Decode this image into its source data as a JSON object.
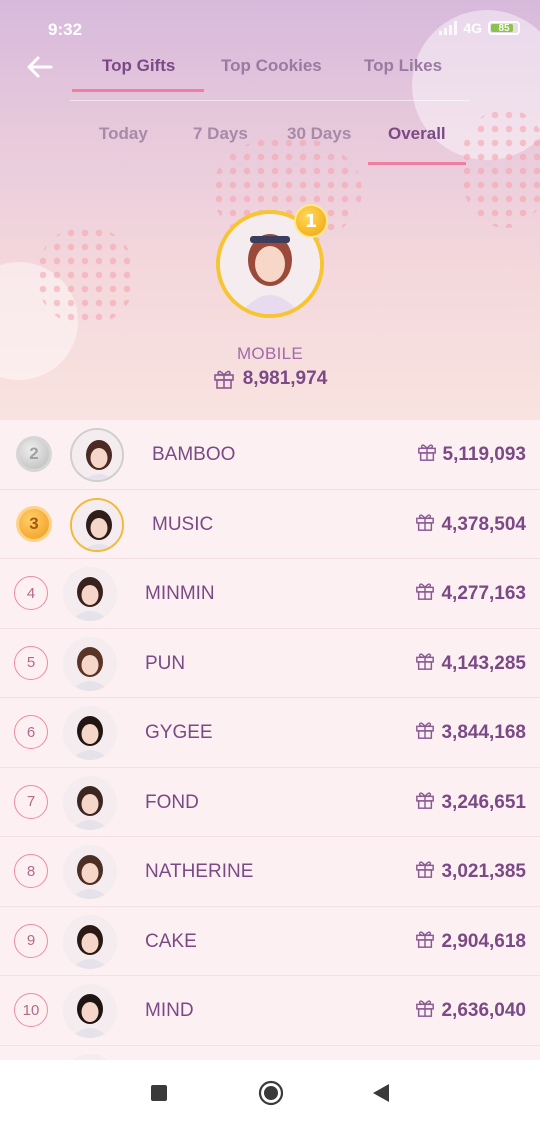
{
  "status": {
    "time": "9:32",
    "network": "4G",
    "battery": "85",
    "battery_level": 0.85
  },
  "nav": {
    "back_icon": "arrow-left-icon"
  },
  "tabs": [
    {
      "label": "Top Gifts",
      "active": true
    },
    {
      "label": "Top Cookies",
      "active": false
    },
    {
      "label": "Top Likes",
      "active": false
    }
  ],
  "periods": [
    {
      "label": "Today",
      "active": false
    },
    {
      "label": "7 Days",
      "active": false
    },
    {
      "label": "30 Days",
      "active": false
    },
    {
      "label": "Overall",
      "active": true
    }
  ],
  "top": {
    "rank": "1",
    "name": "MOBILE",
    "score": "8,981,974",
    "icon": "gift-icon"
  },
  "list": [
    {
      "rank": "2",
      "name": "BAMBOO",
      "score": "5,119,093",
      "medal": "silver"
    },
    {
      "rank": "3",
      "name": "MUSIC",
      "score": "4,378,504",
      "medal": "bronze"
    },
    {
      "rank": "4",
      "name": "MINMIN",
      "score": "4,277,163"
    },
    {
      "rank": "5",
      "name": "PUN",
      "score": "4,143,285"
    },
    {
      "rank": "6",
      "name": "GYGEE",
      "score": "3,844,168"
    },
    {
      "rank": "7",
      "name": "FOND",
      "score": "3,246,651"
    },
    {
      "rank": "8",
      "name": "NATHERINE",
      "score": "3,021,385"
    },
    {
      "rank": "9",
      "name": "CAKE",
      "score": "2,904,618"
    },
    {
      "rank": "10",
      "name": "MIND",
      "score": "2,636,040"
    }
  ],
  "system_nav": {
    "recents_icon": "square-icon",
    "home_icon": "circle-icon",
    "back_icon": "triangle-back-icon"
  },
  "colors": {
    "accent": "#f07ea0",
    "text_primary": "#7b4a86",
    "gold": "#f6c531"
  }
}
